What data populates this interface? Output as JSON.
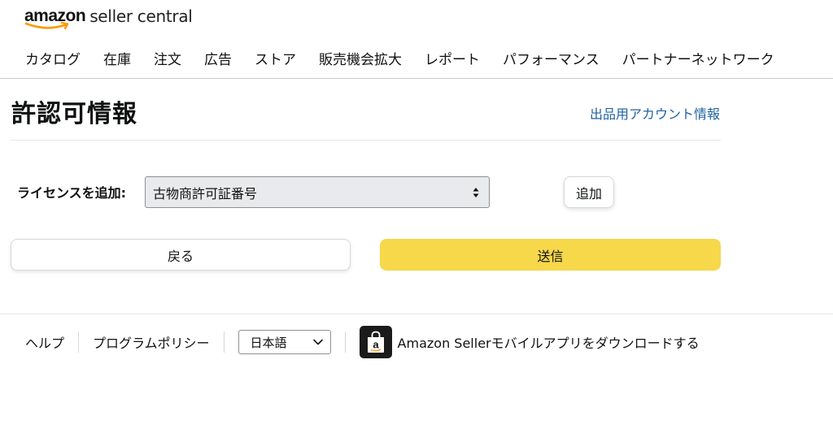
{
  "header": {
    "logo": {
      "brand": "amazon",
      "product": "seller central"
    },
    "nav": [
      "カタログ",
      "在庫",
      "注文",
      "広告",
      "ストア",
      "販売機会拡大",
      "レポート",
      "パフォーマンス",
      "パートナーネットワーク"
    ]
  },
  "page": {
    "title": "許認可情報",
    "account_link": "出品用アカウント情報"
  },
  "form": {
    "license_label": "ライセンスを追加:",
    "license_type_selected": "古物商許可証番号",
    "add_button": "追加",
    "back_button": "戻る",
    "submit_button": "送信"
  },
  "footer": {
    "help": "ヘルプ",
    "program_policy": "プログラムポリシー",
    "language_selected": "日本語",
    "app_download": "Amazon Sellerモバイルアプリをダウンロードする"
  },
  "colors": {
    "primary_button": "#f7d84b",
    "link": "#2162a1",
    "logo_smile": "#ff9900"
  },
  "icons": {
    "select_arrows": "up-down-caret-icon",
    "language_dropdown": "chevron-down-icon",
    "app": "amazon-seller-app-icon"
  }
}
